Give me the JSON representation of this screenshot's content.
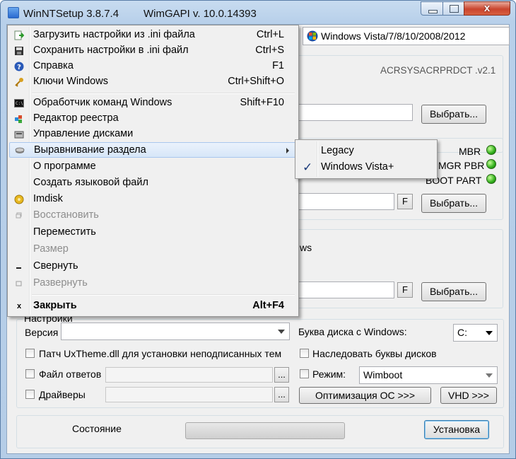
{
  "window": {
    "title": "WinNTSetup 3.8.7.4",
    "wimgapi": "WimGAPI v. 10.0.14393",
    "close_glyph": "x"
  },
  "os_selector": {
    "value": "Windows Vista/7/8/10/2008/2012",
    "icon": "windows-logo-icon"
  },
  "source_group": {
    "id_text": "ACRSYSACRPRDCT .v2.1",
    "select_label": "Выбрать..."
  },
  "boot_group": {
    "status": [
      {
        "label": "MBR",
        "color": "#2fae1a"
      },
      {
        "label": "MGR PBR",
        "color": "#2fae1a"
      },
      {
        "label": "BOOT PART",
        "color": "#2fae1a"
      }
    ],
    "f_label": "F",
    "select_label": "Выбрать..."
  },
  "install_group": {
    "partial_text": "ws",
    "f_label": "F",
    "select_label": "Выбрать..."
  },
  "settings": {
    "group_label": "Настройки",
    "version_label": "Версия",
    "version_value": "",
    "drive_label": "Буква диска с Windows:",
    "drive_value": "C:",
    "uxtheme_label": "Патч UxTheme.dll для установки неподписанных тем",
    "inherit_label": "Наследовать буквы дисков",
    "answer_label": "Файл ответов",
    "mode_label": "Режим:",
    "mode_value": "Wimboot",
    "drivers_label": "Драйверы",
    "browse_label": "...",
    "optimize_label": "Оптимизация ОС >>>",
    "vhd_label": "VHD >>>"
  },
  "footer": {
    "status_label": "Состояние",
    "progress": 0,
    "install_label": "Установка"
  },
  "menu": {
    "items": [
      {
        "label": "Загрузить настройки из .ini файла",
        "shortcut": "Ctrl+L",
        "icon": "load-icon"
      },
      {
        "label": "Сохранить настройки в .ini файл",
        "shortcut": "Ctrl+S",
        "icon": "save-icon"
      },
      {
        "label": "Справка",
        "shortcut": "F1",
        "icon": "help-icon"
      },
      {
        "label": "Ключи Windows",
        "shortcut": "Ctrl+Shift+O",
        "icon": "key-icon"
      },
      {
        "label": "Обработчик команд Windows",
        "shortcut": "Shift+F10",
        "icon": "cmd-icon"
      },
      {
        "label": "Редактор реестра",
        "shortcut": "",
        "icon": "regedit-icon"
      },
      {
        "label": "Управление дисками",
        "shortcut": "",
        "icon": "disk-icon"
      },
      {
        "label": "Выравнивание раздела",
        "shortcut": "",
        "icon": "align-icon"
      },
      {
        "label": "О программе",
        "shortcut": ""
      },
      {
        "label": "Создать языковой файл",
        "shortcut": ""
      },
      {
        "label": "Imdisk",
        "shortcut": "",
        "icon": "imdisk-icon"
      },
      {
        "label": "Восстановить",
        "shortcut": "",
        "icon": "restore-icon"
      },
      {
        "label": "Переместить",
        "shortcut": ""
      },
      {
        "label": "Размер",
        "shortcut": ""
      },
      {
        "label": "Свернуть",
        "shortcut": "",
        "icon": "minimize-icon"
      },
      {
        "label": "Развернуть",
        "shortcut": "",
        "icon": "maximize-icon"
      },
      {
        "label": "Закрыть",
        "shortcut": "Alt+F4",
        "icon": "close-icon"
      }
    ],
    "close_glyph": "x",
    "submenu": [
      {
        "label": "Legacy",
        "checked": false
      },
      {
        "label": "Windows Vista+",
        "checked": true
      }
    ],
    "check_glyph": "✓"
  }
}
